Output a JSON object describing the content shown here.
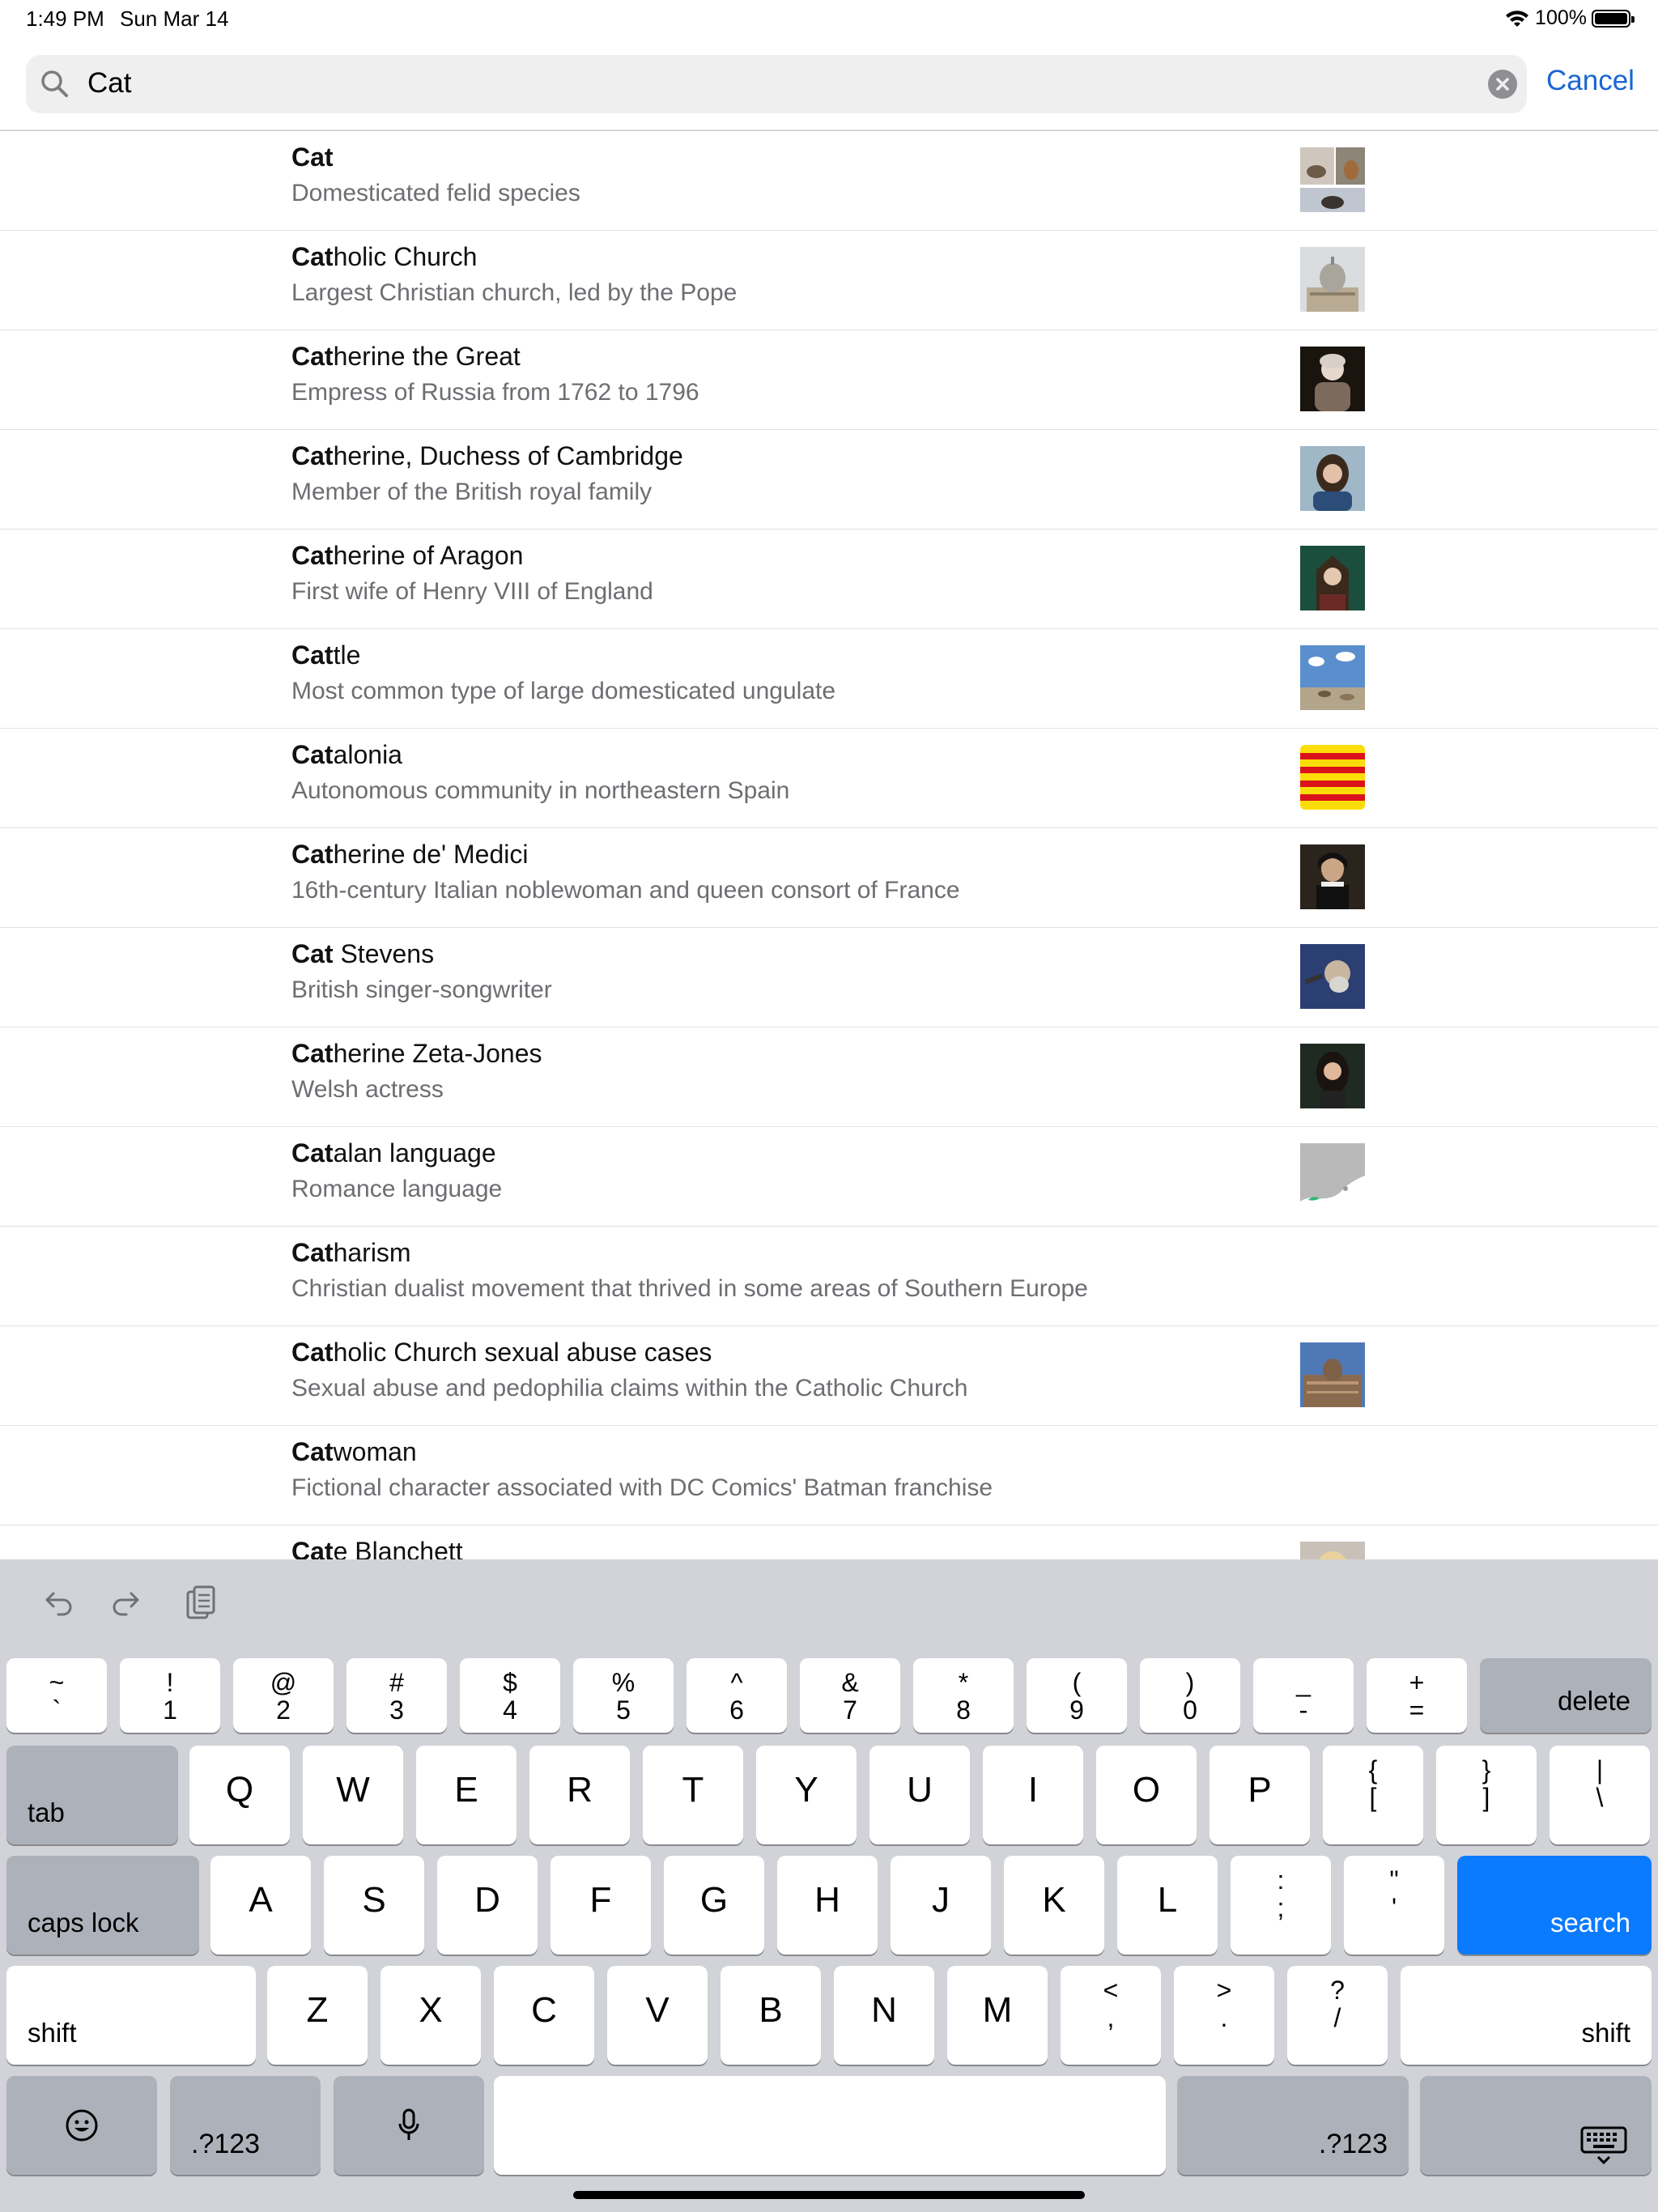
{
  "status_bar": {
    "time": "1:49 PM",
    "date": "Sun Mar 14",
    "battery": "100%"
  },
  "search": {
    "query": "Cat",
    "cancel_label": "Cancel"
  },
  "results": [
    {
      "match": "Cat",
      "rest": "",
      "description": "Domesticated felid species",
      "thumb": "cat-photos"
    },
    {
      "match": "Cat",
      "rest": "holic Church",
      "description": "Largest Christian church, led by the Pope",
      "thumb": "basilica"
    },
    {
      "match": "Cat",
      "rest": "herine the Great",
      "description": "Empress of Russia from 1762 to 1796",
      "thumb": "portrait-empress"
    },
    {
      "match": "Cat",
      "rest": "herine, Duchess of Cambridge",
      "description": "Member of the British royal family",
      "thumb": "portrait-duchess"
    },
    {
      "match": "Cat",
      "rest": "herine of Aragon",
      "description": "First wife of Henry VIII of England",
      "thumb": "portrait-aragon"
    },
    {
      "match": "Cat",
      "rest": "tle",
      "description": "Most common type of large domesticated ungulate",
      "thumb": "cattle-sky"
    },
    {
      "match": "Cat",
      "rest": "alonia",
      "description": "Autonomous community in northeastern Spain",
      "thumb": "catalan-flag"
    },
    {
      "match": "Cat",
      "rest": "herine de' Medici",
      "description": "16th-century Italian noblewoman and queen consort of France",
      "thumb": "portrait-medici"
    },
    {
      "match": "Cat",
      "rest": " Stevens",
      "description": "British singer-songwriter",
      "thumb": "portrait-singer"
    },
    {
      "match": "Cat",
      "rest": "herine Zeta-Jones",
      "description": "Welsh actress",
      "thumb": "portrait-actress"
    },
    {
      "match": "Cat",
      "rest": "alan language",
      "description": "Romance language",
      "thumb": "language-map"
    },
    {
      "match": "Cat",
      "rest": "harism",
      "description": "Christian dualist movement that thrived in some areas of Southern Europe",
      "thumb": ""
    },
    {
      "match": "Cat",
      "rest": "holic Church sexual abuse cases",
      "description": "Sexual abuse and pedophilia claims within the Catholic Church",
      "thumb": "basilica-facade"
    },
    {
      "match": "Cat",
      "rest": "woman",
      "description": "Fictional character associated with DC Comics' Batman franchise",
      "thumb": ""
    },
    {
      "match": "Cat",
      "rest": "e Blanchett",
      "description": "",
      "thumb": "portrait-blonde"
    }
  ],
  "keyboard": {
    "row1": [
      {
        "top": "~",
        "bottom": "`"
      },
      {
        "top": "!",
        "bottom": "1"
      },
      {
        "top": "@",
        "bottom": "2"
      },
      {
        "top": "#",
        "bottom": "3"
      },
      {
        "top": "$",
        "bottom": "4"
      },
      {
        "top": "%",
        "bottom": "5"
      },
      {
        "top": "^",
        "bottom": "6"
      },
      {
        "top": "&",
        "bottom": "7"
      },
      {
        "top": "*",
        "bottom": "8"
      },
      {
        "top": "(",
        "bottom": "9"
      },
      {
        "top": ")",
        "bottom": "0"
      },
      {
        "top": "_",
        "bottom": "-"
      },
      {
        "top": "+",
        "bottom": "="
      }
    ],
    "delete": "delete",
    "tab": "tab",
    "row2": [
      "Q",
      "W",
      "E",
      "R",
      "T",
      "Y",
      "U",
      "I",
      "O",
      "P"
    ],
    "row2_sym": [
      {
        "top": "{",
        "bottom": "["
      },
      {
        "top": "}",
        "bottom": "]"
      },
      {
        "top": "|",
        "bottom": "\\"
      }
    ],
    "caps_lock": "caps lock",
    "row3": [
      "A",
      "S",
      "D",
      "F",
      "G",
      "H",
      "J",
      "K",
      "L"
    ],
    "row3_sym": [
      {
        "top": ":",
        "bottom": ";"
      },
      {
        "top": "\"",
        "bottom": "'"
      }
    ],
    "search": "search",
    "shift": "shift",
    "row4": [
      "Z",
      "X",
      "C",
      "V",
      "B",
      "N",
      "M"
    ],
    "row4_sym": [
      {
        "top": "<",
        "bottom": ","
      },
      {
        "top": ">",
        "bottom": "."
      },
      {
        "top": "?",
        "bottom": "/"
      }
    ],
    "numbers": ".?123"
  },
  "colors": {
    "accent": "#0a7aff",
    "link": "#1a66d2",
    "keyboard_bg": "#d1d3d9"
  }
}
